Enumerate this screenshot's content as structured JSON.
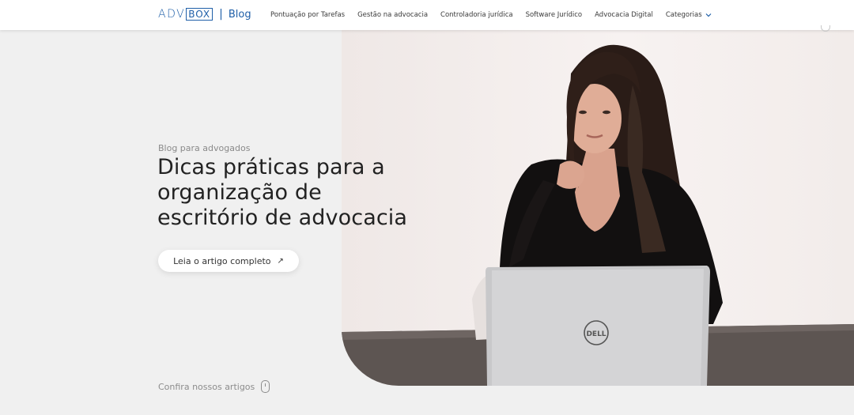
{
  "header": {
    "logo_adv": "ADV",
    "logo_box": "BOX",
    "logo_sep": "|",
    "logo_blog": "Blog",
    "nav": [
      {
        "label": "Pontuação por Tarefas"
      },
      {
        "label": "Gestão na advocacia"
      },
      {
        "label": "Controladoria jurídica"
      },
      {
        "label": "Software Jurídico"
      },
      {
        "label": "Advocacia Digital"
      },
      {
        "label": "Categorias"
      }
    ]
  },
  "hero": {
    "kicker": "Blog para advogados",
    "title_line1": "Dicas práticas para a",
    "title_line2": "organização de",
    "title_line3": "escritório de advocacia",
    "cta_label": "Leia o artigo completo",
    "cta_icon": "arrow-up-right-icon",
    "laptop_brand": "DELL"
  },
  "footer_hint": {
    "label": "Confira nossos artigos",
    "icon": "mouse-icon"
  },
  "colors": {
    "brand": "#1f5fa8",
    "background": "#f0f0f0",
    "header": "#ffffff"
  }
}
